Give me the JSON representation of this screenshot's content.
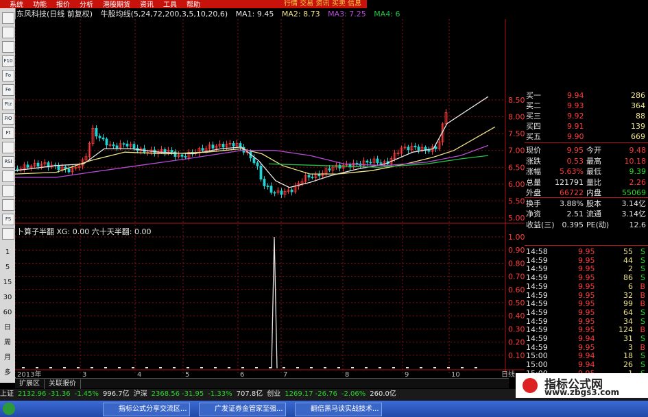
{
  "menu": {
    "items": [
      "系统",
      "功能",
      "报价",
      "分析",
      "港股期货",
      "资讯",
      "工具",
      "帮助"
    ],
    "right_labels": [
      "行情 交易 资讯",
      "买卖 信息"
    ]
  },
  "toolbar": {
    "icons": [
      "chart-icon",
      "line-icon",
      "candle-icon",
      "f10-icon",
      "fo-icon",
      "fe-icon",
      "ftz-icon",
      "fio-icon",
      "ft-icon",
      "search-icon",
      "rsi-icon",
      "zoom-icon",
      "move-icon",
      "info-icon",
      "fs-icon",
      "kline-icon"
    ],
    "labels": [
      "",
      "",
      "",
      "F10",
      "Fo",
      "Fe",
      "Ftz",
      "FiO",
      "Ft",
      "",
      "RSI",
      "",
      "",
      "",
      "FS",
      ""
    ],
    "periods": [
      "1",
      "5",
      "15",
      "30",
      "60",
      "日",
      "周",
      "月",
      "多"
    ]
  },
  "title": {
    "stock": "东风科技(日线 前复权)",
    "indicator": "牛股均线(5,24,72,200,3,5,10,20,6)",
    "ma1": "MA1: 9.45",
    "ma2": "MA2: 8.73",
    "ma3": "MA3: 7.25",
    "ma4": "MA4: 6"
  },
  "sub_title": "卜算子半翻 XG: 0.00  六十天半翻: 0.00",
  "price_axis": [
    "8.50",
    "8.00",
    "7.50",
    "7.00",
    "6.50",
    "6.00",
    "5.50",
    "5.00"
  ],
  "sub_axis": [
    "1.00",
    "0.90",
    "0.80",
    "0.70",
    "0.60",
    "0.50",
    "0.40",
    "0.30",
    "0.20",
    "0.10"
  ],
  "date_axis": [
    "2013年",
    "3",
    "4",
    "5",
    "6",
    "7",
    "8",
    "9",
    "10"
  ],
  "axis_unit": "日线",
  "orderbook": [
    {
      "label": "买一",
      "price": "9.94",
      "vol": "286"
    },
    {
      "label": "买二",
      "price": "9.93",
      "vol": "364"
    },
    {
      "label": "买三",
      "price": "9.92",
      "vol": "88"
    },
    {
      "label": "买四",
      "price": "9.91",
      "vol": "139"
    },
    {
      "label": "买五",
      "price": "9.90",
      "vol": "669"
    }
  ],
  "stats": [
    {
      "l1": "现价",
      "v1": "9.95",
      "l2": "今开",
      "v2": "9.48",
      "c1": "#ff3b3b",
      "c2": "#ff3b3b"
    },
    {
      "l1": "涨跌",
      "v1": "0.53",
      "l2": "最高",
      "v2": "10.18",
      "c1": "#ff3b3b",
      "c2": "#ff3b3b"
    },
    {
      "l1": "涨幅",
      "v1": "5.63%",
      "l2": "最低",
      "v2": "9.39",
      "c1": "#ff3b3b",
      "c2": "#26d926"
    },
    {
      "l1": "总量",
      "v1": "121791",
      "l2": "量比",
      "v2": "2.26",
      "c1": "#e6e6e6",
      "c2": "#ff3b3b"
    },
    {
      "l1": "外盘",
      "v1": "66722",
      "l2": "内盘",
      "v2": "55069",
      "c1": "#ff3b3b",
      "c2": "#26d926"
    },
    {
      "l1": "换手",
      "v1": "3.88%",
      "l2": "股本",
      "v2": "3.14亿",
      "c1": "#e6e6e6",
      "c2": "#e6e6e6"
    },
    {
      "l1": "净资",
      "v1": "2.51",
      "l2": "流通",
      "v2": "3.14亿",
      "c1": "#e6e6e6",
      "c2": "#e6e6e6"
    },
    {
      "l1": "收益(三)",
      "v1": "0.395",
      "l2": "PE(动)",
      "v2": "12.6",
      "c1": "#e6e6e6",
      "c2": "#e6e6e6"
    }
  ],
  "ticks": [
    {
      "time": "14:58",
      "price": "9.95",
      "vol": "55",
      "side": "S"
    },
    {
      "time": "14:59",
      "price": "9.95",
      "vol": "44",
      "side": "S"
    },
    {
      "time": "14:59",
      "price": "9.95",
      "vol": "2",
      "side": "S"
    },
    {
      "time": "14:59",
      "price": "9.95",
      "vol": "86",
      "side": "S"
    },
    {
      "time": "14:59",
      "price": "9.95",
      "vol": "6",
      "side": "B"
    },
    {
      "time": "14:59",
      "price": "9.95",
      "vol": "32",
      "side": "B"
    },
    {
      "time": "14:59",
      "price": "9.95",
      "vol": "99",
      "side": "B"
    },
    {
      "time": "14:59",
      "price": "9.95",
      "vol": "64",
      "side": "S"
    },
    {
      "time": "14:59",
      "price": "9.95",
      "vol": "34",
      "side": "S"
    },
    {
      "time": "14:59",
      "price": "9.95",
      "vol": "124",
      "side": "B"
    },
    {
      "time": "14:59",
      "price": "9.94",
      "vol": "31",
      "side": "S"
    },
    {
      "time": "14:59",
      "price": "9.95",
      "vol": "3",
      "side": "B"
    },
    {
      "time": "15:00",
      "price": "9.94",
      "vol": "18",
      "side": "S"
    },
    {
      "time": "15:00",
      "price": "9.94",
      "vol": "26",
      "side": "S"
    },
    {
      "time": "15:00",
      "price": "9.95",
      "vol": "1",
      "side": "S"
    }
  ],
  "tabs": [
    "扩展区",
    "关联报价"
  ],
  "status": [
    {
      "label": "上证",
      "value": "2132.96",
      "chg": "-31.36",
      "pct": "-1.45%",
      "amt": "996.7亿"
    },
    {
      "label": "沪深",
      "value": "2368.56",
      "chg": "-31.95",
      "pct": "-1.33%",
      "amt": "707.8亿"
    },
    {
      "label": "创业",
      "value": "1269.17",
      "chg": "-26.76",
      "pct": "-2.06%",
      "amt": "260.0亿"
    }
  ],
  "status_right": "广发证券",
  "taskbar": [
    "指标公式分享交流区...",
    "广发证券金管家至强...",
    "翻倍黑马谈实战技术..."
  ],
  "watermark": {
    "title": "指标公式网",
    "url": "www.zbgs3.com"
  },
  "colors": {
    "up": "#ff3b3b",
    "down": "#22d3d3",
    "ma1": "#e8e8e8",
    "ma2": "#f0e68c",
    "ma3": "#b84dd6",
    "ma4": "#26c34a",
    "grid": "#8b1010"
  }
}
